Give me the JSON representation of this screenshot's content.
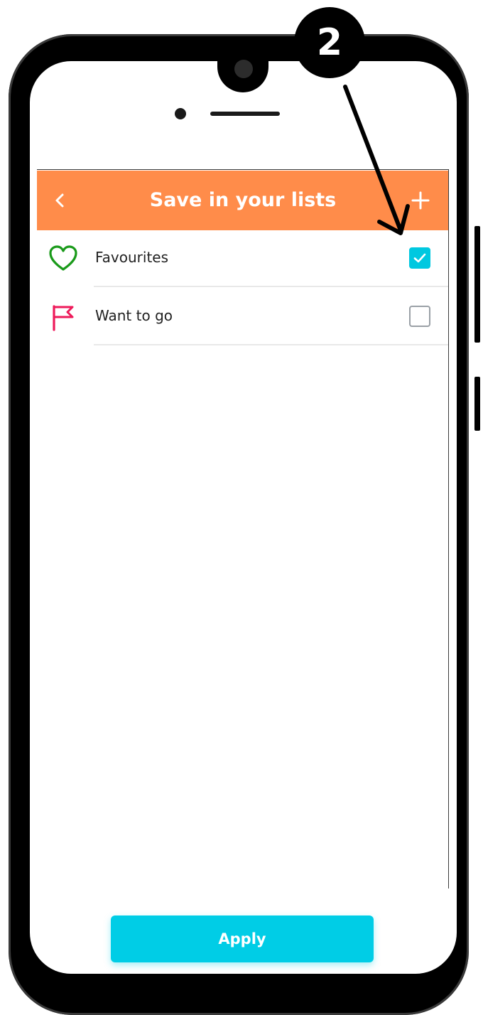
{
  "header": {
    "back_icon": "chevron-left-icon",
    "title": "Save in your lists",
    "add_icon": "plus-icon"
  },
  "lists": [
    {
      "label": "Favourites",
      "icon": "heart-icon",
      "icon_color": "#1a9a1a",
      "checked": true
    },
    {
      "label": "Want to go",
      "icon": "flag-icon",
      "icon_color": "#ee1a5a",
      "checked": false
    }
  ],
  "apply_label": "Apply",
  "annotation": {
    "step_number": "2"
  },
  "colors": {
    "header_bg": "#ff8c4a",
    "accent": "#00cde6"
  }
}
